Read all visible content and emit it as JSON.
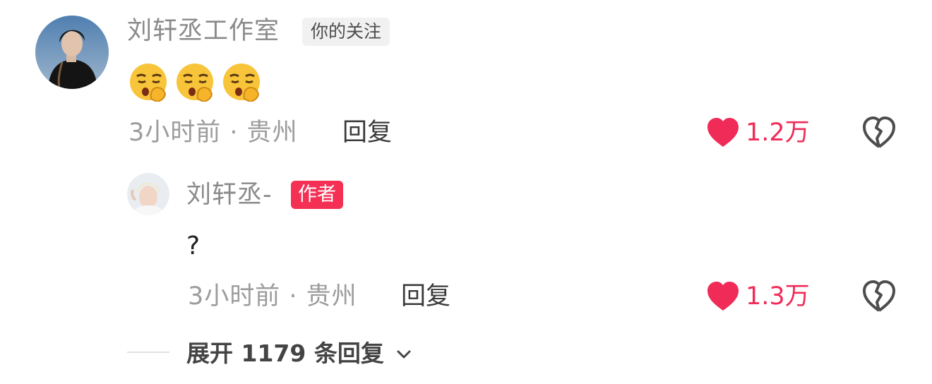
{
  "comment": {
    "author": "刘轩丞工作室",
    "relation_tag": "你的关注",
    "emojis": [
      "shushing-face-emoji",
      "shushing-face-emoji",
      "shushing-face-emoji"
    ],
    "meta": "3小时前 · 贵州",
    "reply_label": "回复",
    "like_count": "1.2万"
  },
  "reply": {
    "author": "刘轩丞-",
    "author_tag": "作者",
    "text": "?",
    "meta": "3小时前 · 贵州",
    "reply_label": "回复",
    "like_count": "1.3万"
  },
  "expand": {
    "label": "展开 1179 条回复"
  },
  "colors": {
    "like": "#f02b57",
    "author_tag": "#f53055",
    "muted_text": "#9c9c9c"
  }
}
